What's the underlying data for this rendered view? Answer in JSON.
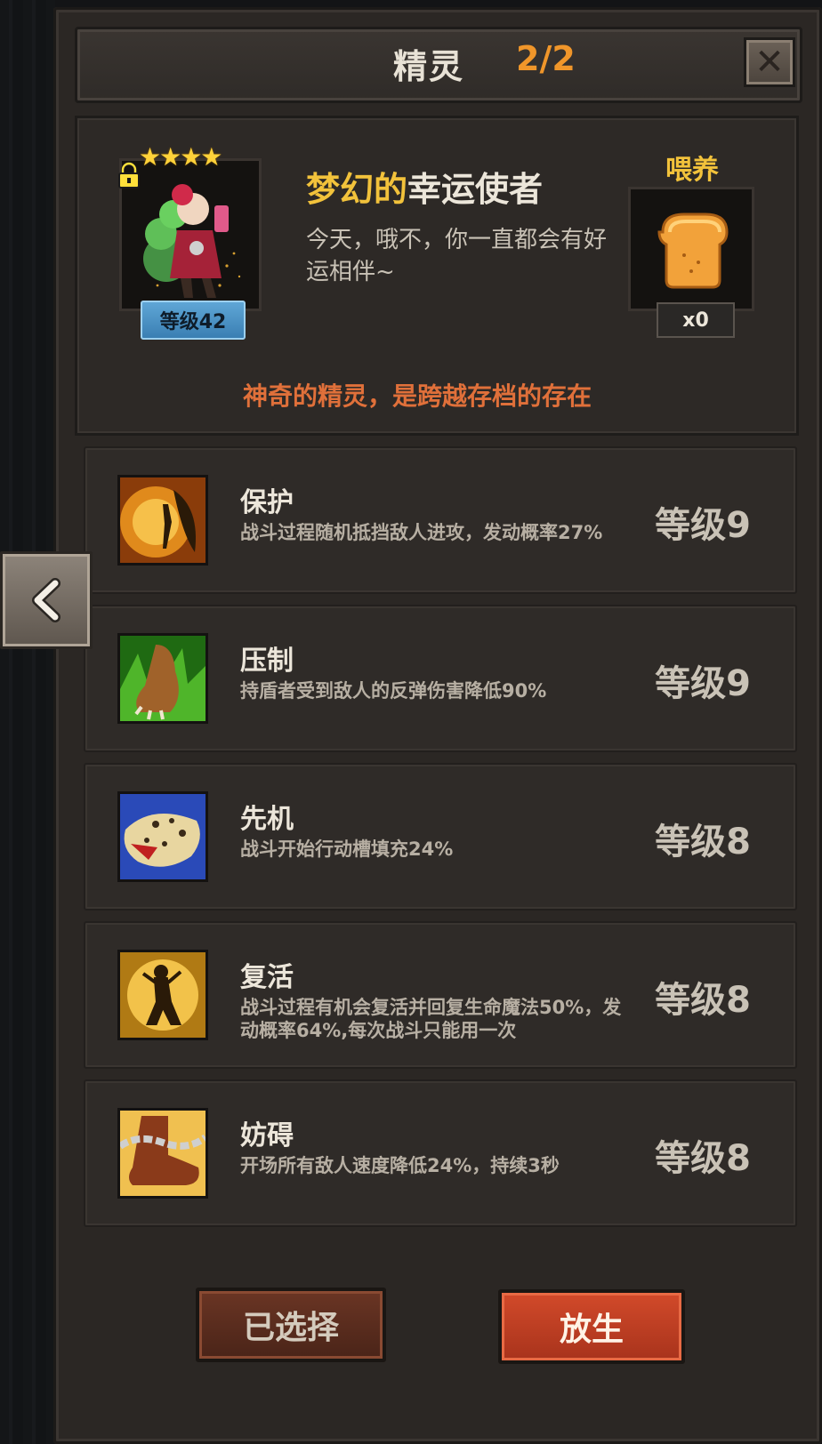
{
  "title": "精灵",
  "title_count": "2/2",
  "pet": {
    "stars": "★★★★",
    "level": "等级42",
    "name_prefix": "梦幻的",
    "name_suffix": "幸运使者",
    "description": "今天，哦不，你一直都会有好运相伴~"
  },
  "feed": {
    "label": "喂养",
    "count": "x0"
  },
  "notice": "神奇的精灵，是跨越存档的存在",
  "skills": [
    {
      "name": "保护",
      "desc": "战斗过程随机抵挡敌人进攻，发动概率27%",
      "level": "等级9",
      "icon": "fairy-shield-icon"
    },
    {
      "name": "压制",
      "desc": "持盾者受到敌人的反弹伤害降低90%",
      "level": "等级9",
      "icon": "beast-claw-icon"
    },
    {
      "name": "先机",
      "desc": "战斗开始行动槽填充24%",
      "level": "等级8",
      "icon": "leopard-icon"
    },
    {
      "name": "复活",
      "desc": "战斗过程有机会复活并回复生命魔法50%，发动概率64%,每次战斗只能用一次",
      "level": "等级8",
      "icon": "revive-figure-icon"
    },
    {
      "name": "妨碍",
      "desc": "开场所有敌人速度降低24%，持续3秒",
      "level": "等级8",
      "icon": "chained-boot-icon"
    }
  ],
  "buttons": {
    "selected": "已选择",
    "release": "放生"
  }
}
